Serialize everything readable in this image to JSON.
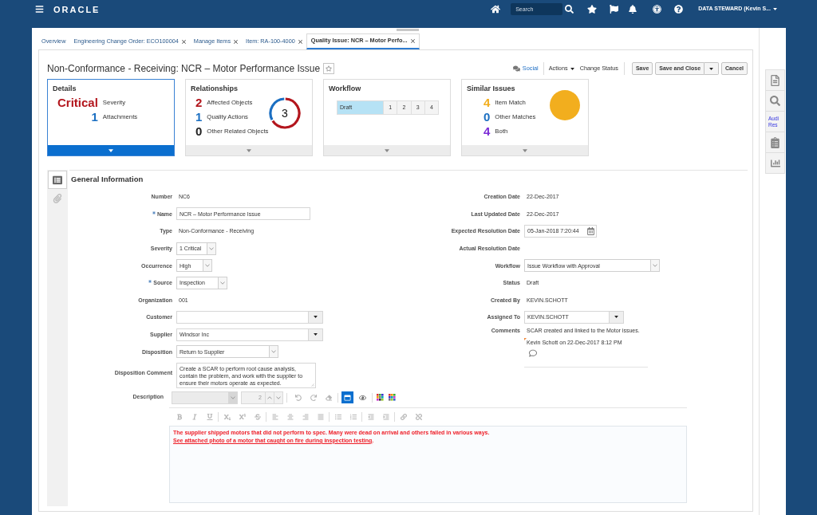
{
  "header": {
    "logo": "ORACLE",
    "search": {
      "placeholder": "Search"
    },
    "user": "DATA STEWARD (Kevin S..."
  },
  "tabs": [
    {
      "label": "Overview",
      "closable": false,
      "selected": false
    },
    {
      "label": "Engineering Change Order: ECO100004",
      "closable": true,
      "selected": false
    },
    {
      "label": "Manage Items",
      "closable": true,
      "selected": false
    },
    {
      "label": "Item: RA-100-4000",
      "closable": true,
      "selected": false
    },
    {
      "label": "Quality Issue: NCR – Motor Perfo...",
      "closable": true,
      "selected": true
    }
  ],
  "page": {
    "title": "Non-Conformance - Receiving: NCR – Motor Performance Issue",
    "favorite": false,
    "social": "Social",
    "menus": [
      {
        "label": "Actions",
        "kind": "menu"
      },
      {
        "label": "Change Status",
        "kind": "link"
      }
    ],
    "buttons": [
      {
        "label": "Save",
        "kind": "plain"
      },
      {
        "label": "Save and Close",
        "kind": "split"
      },
      {
        "label": "Cancel",
        "kind": "plain"
      }
    ]
  },
  "cards": [
    {
      "title": "Details",
      "selected": true,
      "kind": "list",
      "items": [
        {
          "count": "Critical",
          "label": "Severity",
          "color": "#b3161d"
        },
        {
          "count": "1",
          "label": "Attachments",
          "color": "#1b6fc2"
        }
      ]
    },
    {
      "title": "Relationships",
      "selected": false,
      "kind": "donut",
      "total": "3",
      "items": [
        {
          "count": "2",
          "label": "Affected Objects",
          "color": "#b3161d"
        },
        {
          "count": "1",
          "label": "Quality Actions",
          "color": "#1b6fc2"
        },
        {
          "count": "0",
          "label": "Other Related Objects",
          "color": "#222222"
        }
      ]
    },
    {
      "title": "Workflow",
      "selected": false,
      "kind": "stages",
      "stages": [
        {
          "label": "Draft",
          "selected": true
        },
        {
          "label": "1",
          "selected": false
        },
        {
          "label": "2",
          "selected": false
        },
        {
          "label": "3",
          "selected": false
        },
        {
          "label": "4",
          "selected": false
        }
      ]
    },
    {
      "title": "Similar Issues",
      "selected": false,
      "kind": "pie",
      "items": [
        {
          "count": "4",
          "label": "Item Match",
          "color": "#f2ae1e"
        },
        {
          "count": "0",
          "label": "Other Matches",
          "color": "#1b6fc2"
        },
        {
          "count": "4",
          "label": "Both",
          "color": "#7b2bd6"
        }
      ]
    }
  ],
  "section": {
    "title": "General Information",
    "rail": [
      {
        "selected": true
      },
      {
        "selected": false
      }
    ]
  },
  "left_fields": [
    {
      "label": "Number",
      "kind": "text",
      "required": false,
      "value": "NC6"
    },
    {
      "label": "Name",
      "kind": "input",
      "required": true,
      "value": "NCR – Motor Performance Issue"
    },
    {
      "label": "Type",
      "kind": "text",
      "required": false,
      "value": "Non-Conformance - Receiving"
    },
    {
      "label": "Severity",
      "kind": "select",
      "required": false,
      "value": "1 Critical"
    },
    {
      "label": "Occurrence",
      "kind": "select",
      "required": false,
      "value": "High"
    },
    {
      "label": "Source",
      "kind": "select",
      "required": true,
      "value": "Inspection"
    },
    {
      "label": "Organization",
      "kind": "text",
      "required": false,
      "value": "001"
    },
    {
      "label": "Customer",
      "kind": "combo",
      "required": false
    },
    {
      "label": "Supplier",
      "kind": "combo",
      "required": false,
      "value": "Windsor Inc"
    },
    {
      "label": "Disposition",
      "kind": "select",
      "required": false,
      "value": "Return to Supplier"
    },
    {
      "label": "Disposition Comment",
      "kind": "textarea",
      "required": false,
      "value": "Create a SCAR to perform root cause analysis, contain the problem, and work with the supplier to ensure their motors operate as expected."
    }
  ],
  "right_fields": [
    {
      "label": "Creation Date",
      "kind": "text",
      "required": false,
      "value": "22-Dec-2017"
    },
    {
      "label": "Last Updated Date",
      "kind": "text",
      "required": false,
      "value": "22-Dec-2017"
    },
    {
      "label": "Expected Resolution Date",
      "kind": "date",
      "required": false,
      "value": "05-Jan-2018 7:20:44"
    },
    {
      "label": "Actual Resolution Date",
      "kind": "text",
      "required": false
    },
    {
      "label": "Workflow",
      "kind": "select",
      "required": false,
      "value": "Issue Workflow with Approval"
    },
    {
      "label": "Status",
      "kind": "text",
      "required": false,
      "value": "Draft"
    },
    {
      "label": "Created By",
      "kind": "text",
      "required": false,
      "value": "KEVIN.SCHOTT"
    },
    {
      "label": "Assigned To",
      "kind": "combo",
      "required": false,
      "value": "KEVIN.SCHOTT"
    },
    {
      "label": "Comments",
      "kind": "comments",
      "required": false,
      "value": "SCAR created and linked to the Motor issues.",
      "author": "Kevin Schott on 22-Dec-2017 8:12 PM"
    }
  ],
  "description": {
    "label": "Description",
    "font_size": "2",
    "modes": [
      {
        "kind": "rich",
        "selected": true
      },
      {
        "kind": "source",
        "selected": false
      }
    ],
    "text": "The supplier shipped motors that did not perform to spec. Many were dead on arrival and others failed in various ways.",
    "link": "See attached photo of a motor that caught on fire during inspection testing",
    "end": "."
  },
  "side_tray": {
    "label": "Audi Res"
  }
}
